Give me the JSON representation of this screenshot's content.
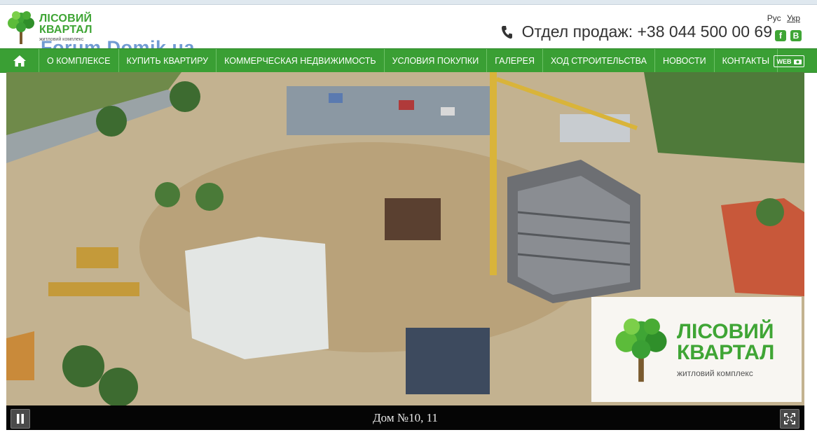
{
  "header": {
    "logo": {
      "line1": "ЛІСОВИЙ",
      "line2": "КВАРТАЛ",
      "line3": "житловий комплекс"
    },
    "watermark": "Forum.Domik.ua",
    "languages": [
      {
        "label": "Рус",
        "active": false
      },
      {
        "label": "Укр",
        "active": true
      }
    ],
    "phone": "Отдел продаж: +38 044 500 00 69",
    "social": [
      {
        "icon": "facebook-icon",
        "glyph": "f"
      },
      {
        "icon": "vk-icon",
        "glyph": "В"
      }
    ]
  },
  "nav": {
    "home_icon": "home-icon",
    "items": [
      {
        "label": "О КОМПЛЕКСЕ"
      },
      {
        "label": "КУПИТЬ КВАРТИРУ"
      },
      {
        "label": "КОММЕРЧЕСКАЯ НЕДВИЖИМОСТЬ"
      },
      {
        "label": "УСЛОВИЯ ПОКУПКИ"
      },
      {
        "label": "ГАЛЕРЕЯ"
      },
      {
        "label": "ХОД СТРОИТЕЛЬСТВА"
      },
      {
        "label": "НОВОСТИ"
      },
      {
        "label": "КОНТАКТЫ"
      }
    ],
    "webcam_label": "WEB"
  },
  "video": {
    "overlay_logo": {
      "line1": "ЛІСОВИЙ",
      "line2": "КВАРТАЛ",
      "line3": "житловий комплекс"
    },
    "caption": "Дом №10, 11",
    "pause_icon": "pause-icon",
    "fullscreen_icon": "fullscreen-icon"
  },
  "colors": {
    "brand_green": "#3fa535",
    "nav_green": "#3a9f34",
    "control_bar": "#050505"
  }
}
